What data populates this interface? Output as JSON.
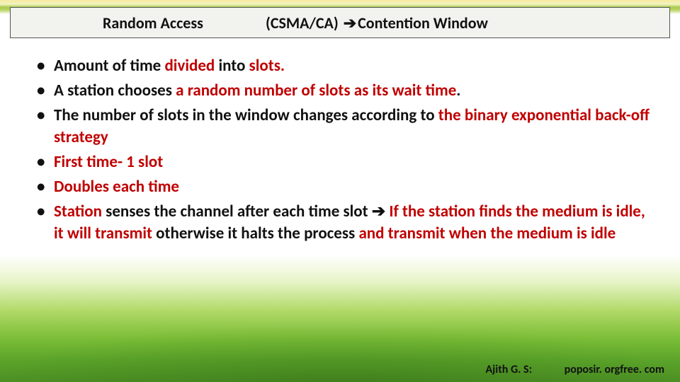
{
  "title": {
    "left": "Random Access",
    "right_prefix": "(CSMA/CA) ",
    "right_arrow": "➔",
    "right_suffix": "Contention Window"
  },
  "bullets": [
    {
      "segments": [
        {
          "text": "Amount of time ",
          "color": "black"
        },
        {
          "text": "divided ",
          "color": "red"
        },
        {
          "text": "into ",
          "color": "black"
        },
        {
          "text": "slots.",
          "color": "red"
        }
      ]
    },
    {
      "segments": [
        {
          "text": "A station chooses ",
          "color": "black"
        },
        {
          "text": "a random number of slots as its wait time",
          "color": "red"
        },
        {
          "text": ".",
          "color": "black"
        }
      ]
    },
    {
      "segments": [
        {
          "text": "The number of slots in the window changes according to ",
          "color": "black"
        },
        {
          "text": "the ",
          "color": "red"
        },
        {
          "text": "binary exponential back-off strategy",
          "color": "red"
        }
      ]
    },
    {
      "segments": [
        {
          "text": " First time- 1 slot",
          "color": "red"
        }
      ]
    },
    {
      "segments": [
        {
          "text": " Doubles each time",
          "color": "red"
        }
      ]
    },
    {
      "segments": [
        {
          "text": " Station ",
          "color": "red"
        },
        {
          "text": "senses the channel after each time slot ",
          "color": "black"
        },
        {
          "text": "➔ ",
          "color": "black"
        },
        {
          "text": "If the station finds the medium is idle, it will transmit ",
          "color": "red"
        },
        {
          "text": "otherwise it halts the process ",
          "color": "black"
        },
        {
          "text": "and transmit when the medium is idle",
          "color": "red"
        }
      ]
    }
  ],
  "footer": {
    "author": "Ajith G. S:",
    "site": "poposir. orgfree. com"
  },
  "colors": {
    "red": "#c00000",
    "black": "#111111"
  }
}
